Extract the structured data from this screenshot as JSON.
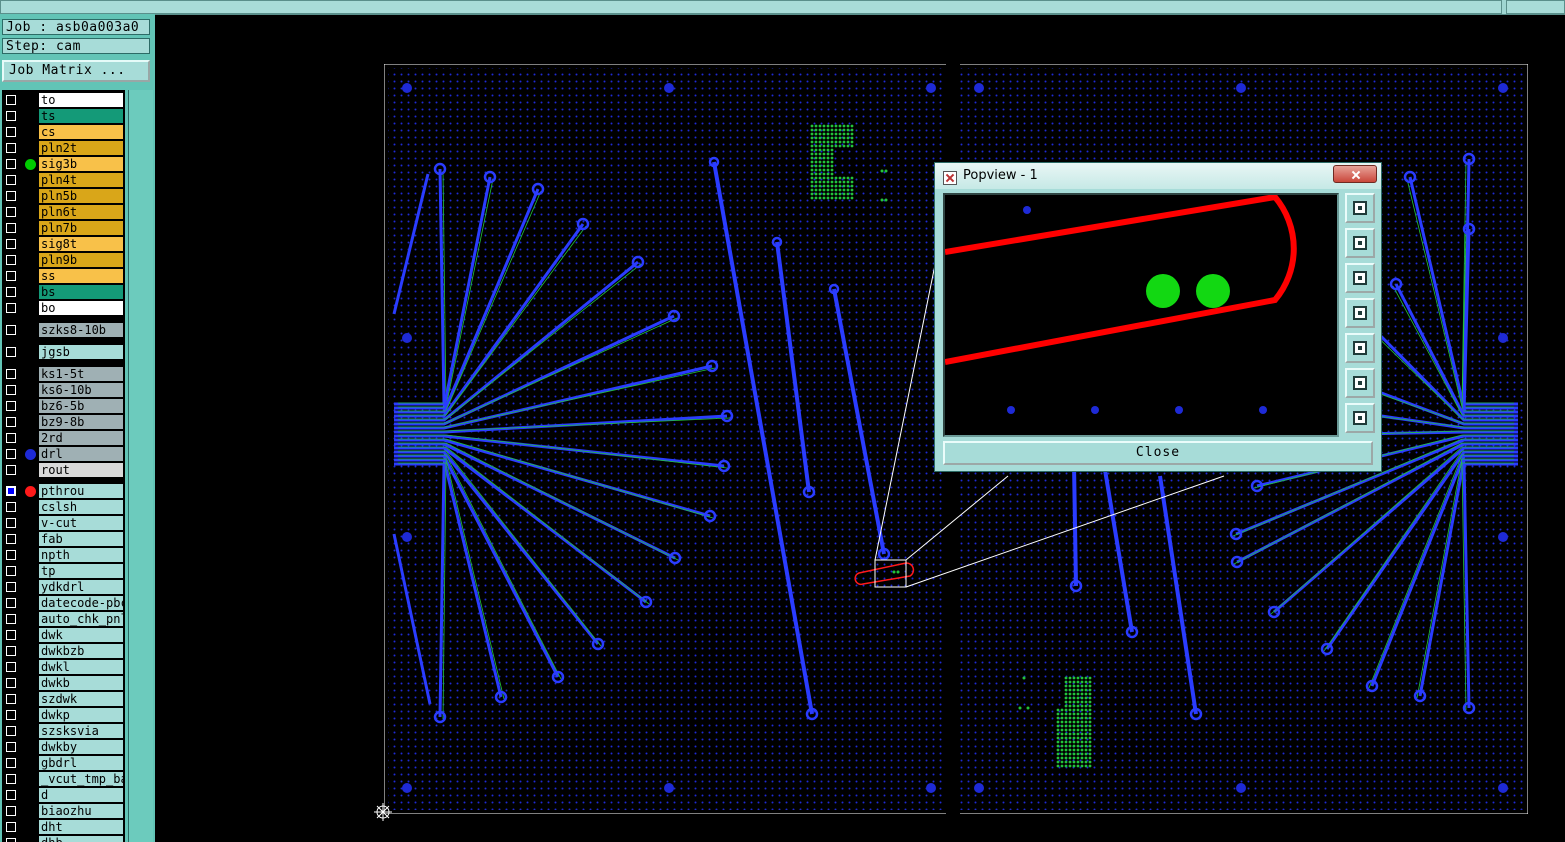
{
  "job_label": "Job : asb0a003a0",
  "step_label": "Step: cam",
  "job_matrix_button": "Job Matrix ...",
  "colors": {
    "copper": "#1e2ad6",
    "trace": "#2a3cff",
    "signal": "#22c33a",
    "route": "#ff0000",
    "panel_bg": "#a7dcd8",
    "left_bg": "#62c4b6"
  },
  "layers": [
    {
      "name": "to",
      "bg": "#ffffff"
    },
    {
      "name": "ts",
      "bg": "#149a78"
    },
    {
      "name": "cs",
      "bg": "#f8c149"
    },
    {
      "name": "pln2t",
      "bg": "#d9a619"
    },
    {
      "name": "sig3b",
      "bg": "#f8c149",
      "dot": "#00cc00"
    },
    {
      "name": "pln4t",
      "bg": "#d9a619"
    },
    {
      "name": "pln5b",
      "bg": "#d9a619"
    },
    {
      "name": "pln6t",
      "bg": "#d9a619"
    },
    {
      "name": "pln7b",
      "bg": "#d9a619"
    },
    {
      "name": "sig8t",
      "bg": "#f8c149"
    },
    {
      "name": "pln9b",
      "bg": "#d9a619"
    },
    {
      "name": "ss",
      "bg": "#f8c149"
    },
    {
      "name": "bs",
      "bg": "#149a78"
    },
    {
      "name": "bo",
      "bg": "#ffffff"
    },
    {
      "name": "szks8-10b",
      "bg": "#9fb0b4",
      "gap": 6
    },
    {
      "name": "jgsb",
      "bg": "#a7dcd8",
      "gap": 6
    },
    {
      "name": "ks1-5t",
      "bg": "#9fb0b4",
      "gap": 6
    },
    {
      "name": "ks6-10b",
      "bg": "#9fb0b4"
    },
    {
      "name": "bz6-5b",
      "bg": "#9fb0b4"
    },
    {
      "name": "bz9-8b",
      "bg": "#9fb0b4"
    },
    {
      "name": "2rd",
      "bg": "#9fb0b4"
    },
    {
      "name": "drl",
      "bg": "#9fb0b4",
      "dot": "#1e2ad6"
    },
    {
      "name": "rout",
      "bg": "#d9d9d9"
    },
    {
      "name": "pthrou",
      "bg": "#a7dcd8",
      "dot": "#ff1a1a",
      "on": true,
      "gap": 5
    },
    {
      "name": "cslsh",
      "bg": "#a7dcd8"
    },
    {
      "name": "v-cut",
      "bg": "#a7dcd8"
    },
    {
      "name": "fab",
      "bg": "#a7dcd8"
    },
    {
      "name": "npth",
      "bg": "#a7dcd8"
    },
    {
      "name": "tp",
      "bg": "#a7dcd8"
    },
    {
      "name": "ydkdrl",
      "bg": "#a7dcd8"
    },
    {
      "name": "datecode-pbc",
      "bg": "#a7dcd8"
    },
    {
      "name": "auto_chk_pnl",
      "bg": "#a7dcd8"
    },
    {
      "name": "dwk",
      "bg": "#a7dcd8"
    },
    {
      "name": "dwkbzb",
      "bg": "#a7dcd8"
    },
    {
      "name": "dwkl",
      "bg": "#a7dcd8"
    },
    {
      "name": "dwkb",
      "bg": "#a7dcd8"
    },
    {
      "name": "szdwk",
      "bg": "#a7dcd8"
    },
    {
      "name": "dwkp",
      "bg": "#a7dcd8"
    },
    {
      "name": "szsksvia",
      "bg": "#a7dcd8"
    },
    {
      "name": "dwkby",
      "bg": "#a7dcd8"
    },
    {
      "name": "gbdrl",
      "bg": "#a7dcd8"
    },
    {
      "name": "_vcut_tmp_bak",
      "bg": "#a7dcd8"
    },
    {
      "name": "d",
      "bg": "#a7dcd8"
    },
    {
      "name": "biaozhu",
      "bg": "#a7dcd8"
    },
    {
      "name": "dht",
      "bg": "#a7dcd8"
    },
    {
      "name": "dhb",
      "bg": "#a7dcd8"
    }
  ],
  "popview": {
    "title": "Popview - 1",
    "close_button": "Close",
    "tools": [
      "zoom-window-icon",
      "zoom-in-icon",
      "zoom-out-icon",
      "pan-left-icon",
      "pan-right-icon",
      "fit-all-icon",
      "fit-screen-icon"
    ]
  }
}
